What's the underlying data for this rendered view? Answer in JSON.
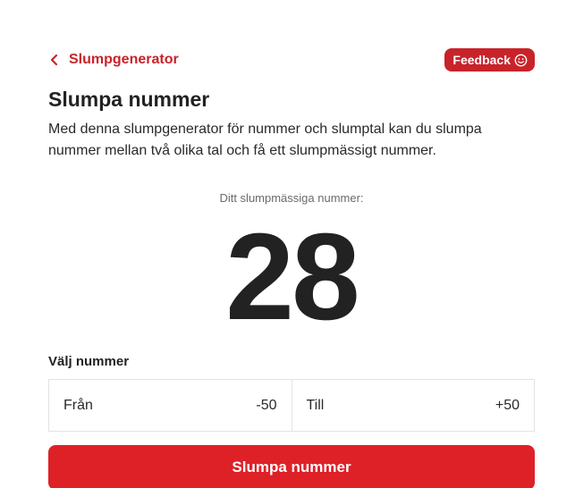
{
  "nav": {
    "back_label": "Slumpgenerator",
    "feedback_label": "Feedback"
  },
  "header": {
    "title": "Slumpa nummer",
    "description": "Med denna slumpgenerator för nummer och slumptal kan du slumpa nummer mellan två olika tal och få ett slumpmässigt nummer."
  },
  "result": {
    "label": "Ditt slumpmässiga nummer:",
    "value": "28"
  },
  "range": {
    "label": "Välj nummer",
    "from_label": "Från",
    "from_value": "-50",
    "to_label": "Till",
    "to_value": "+50"
  },
  "action": {
    "submit_label": "Slumpa nummer"
  },
  "colors": {
    "accent": "#c8232a",
    "button": "#de2127",
    "text": "#222222"
  },
  "icons": {
    "back": "chevron-left-icon",
    "feedback": "smiley-icon"
  }
}
